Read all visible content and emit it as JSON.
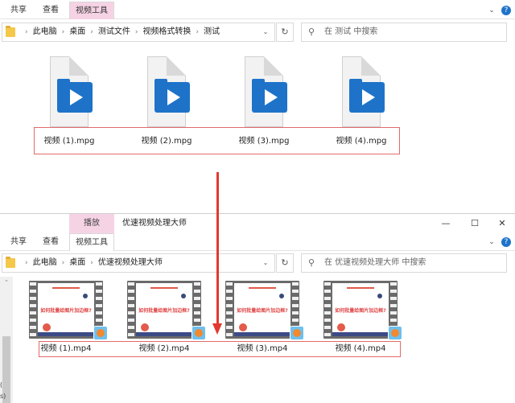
{
  "window1": {
    "ribbon_tabs": [
      "共享",
      "查看",
      "视频工具"
    ],
    "breadcrumb": [
      "此电脑",
      "桌面",
      "测试文件",
      "视频格式转换",
      "测试"
    ],
    "search_placeholder": "在 测试 中搜索",
    "files": [
      "视频 (1).mpg",
      "视频 (2).mpg",
      "视频 (3).mpg",
      "视频 (4).mpg"
    ]
  },
  "window2": {
    "context_tab": "播放",
    "title": "优速视频处理大师",
    "ribbon_tabs": [
      "共享",
      "查看",
      "视频工具"
    ],
    "breadcrumb": [
      "此电脑",
      "桌面",
      "优速视频处理大师"
    ],
    "search_placeholder": "在 优速视频处理大师 中搜索",
    "thumbnail_text": "如何批量给图片加边框?",
    "files": [
      "视频 (1).mp4",
      "视频 (2).mp4",
      "视频 (3).mp4",
      "视频 (4).mp4"
    ],
    "nav_fragments": [
      "(",
      "s)"
    ]
  },
  "icons": {
    "minimize": "—",
    "maximize": "☐",
    "close": "✕",
    "expand": "⌄",
    "help": "?",
    "dropdown": "⌄",
    "refresh": "↻",
    "search": "⚲",
    "up": "⌃"
  },
  "colors": {
    "context_tab": "#f6d3e4",
    "highlight_box": "#e26a6a",
    "arrow": "#e03a2e",
    "video_icon": "#1e73c9"
  }
}
